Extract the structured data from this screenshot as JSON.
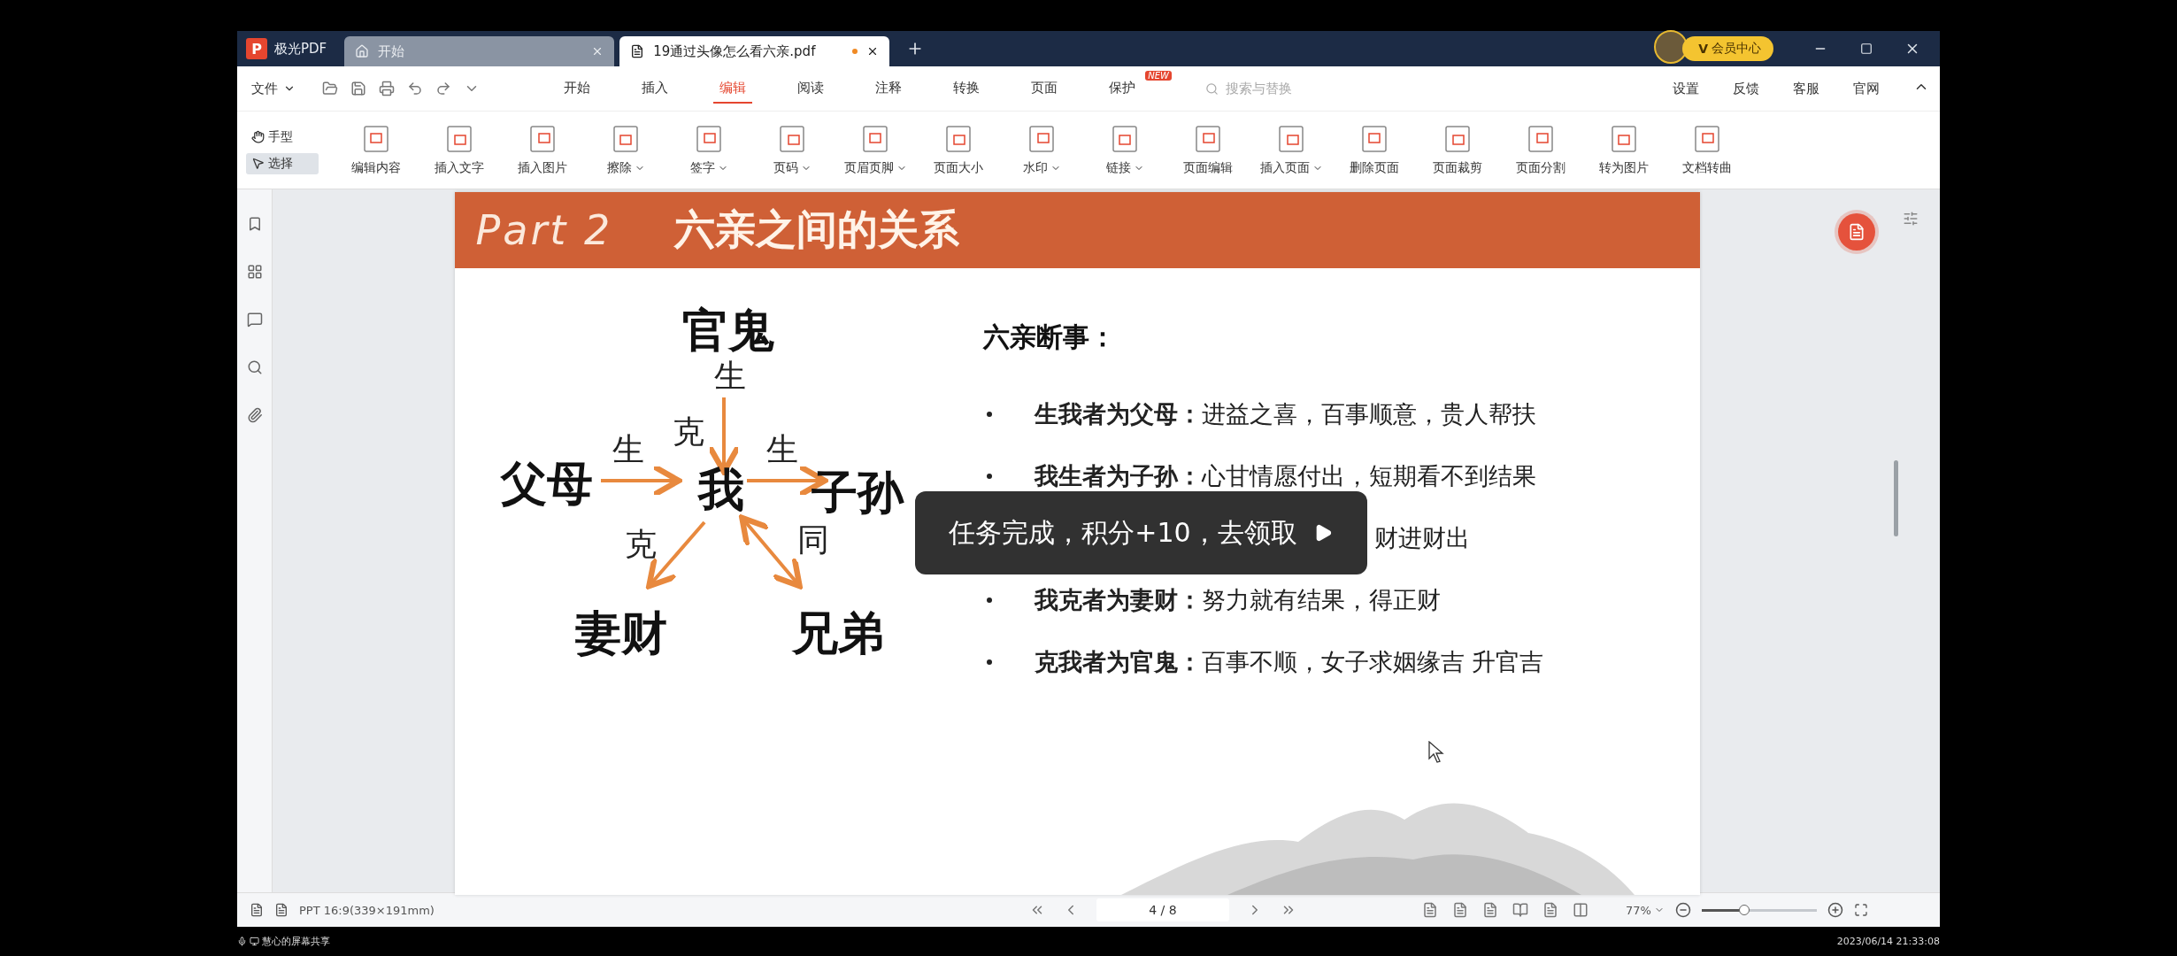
{
  "app": {
    "name": "极光PDF",
    "logo_letter": "P"
  },
  "tabs": [
    {
      "label": "开始",
      "selected": false,
      "unsaved": false
    },
    {
      "label": "19通过头像怎么看六亲.pdf",
      "selected": true,
      "unsaved": true
    }
  ],
  "member_button": {
    "mark": "V",
    "label": "会员中心"
  },
  "menu": {
    "file": "文件",
    "items": [
      {
        "label": "开始",
        "selected": false
      },
      {
        "label": "插入",
        "selected": false
      },
      {
        "label": "编辑",
        "selected": true
      },
      {
        "label": "阅读",
        "selected": false
      },
      {
        "label": "注释",
        "selected": false
      },
      {
        "label": "转换",
        "selected": false
      },
      {
        "label": "页面",
        "selected": false
      },
      {
        "label": "保护",
        "selected": false,
        "badge": "NEW"
      }
    ],
    "search": {
      "placeholder": "搜索与替换"
    },
    "links": [
      "设置",
      "反馈",
      "客服",
      "官网"
    ]
  },
  "tools": {
    "modes": [
      {
        "label": "手型",
        "selected": false
      },
      {
        "label": "选择",
        "selected": true
      }
    ],
    "items": [
      {
        "label": "编辑内容",
        "dropdown": false
      },
      {
        "label": "插入文字",
        "dropdown": false
      },
      {
        "label": "插入图片",
        "dropdown": false
      },
      {
        "label": "擦除",
        "dropdown": true
      },
      {
        "label": "签字",
        "dropdown": true
      },
      {
        "label": "页码",
        "dropdown": true
      },
      {
        "label": "页眉页脚",
        "dropdown": true
      },
      {
        "label": "页面大小",
        "dropdown": false
      },
      {
        "label": "水印",
        "dropdown": true
      },
      {
        "label": "链接",
        "dropdown": true
      },
      {
        "label": "页面编辑",
        "dropdown": false
      },
      {
        "label": "插入页面",
        "dropdown": true
      },
      {
        "label": "删除页面",
        "dropdown": false
      },
      {
        "label": "页面裁剪",
        "dropdown": false
      },
      {
        "label": "页面分割",
        "dropdown": false
      },
      {
        "label": "转为图片",
        "dropdown": false
      },
      {
        "label": "文档转曲",
        "dropdown": false
      }
    ]
  },
  "slide": {
    "part": "Part 2",
    "title": "六亲之间的关系",
    "diagram": {
      "nodes": [
        "官鬼",
        "父母",
        "我",
        "子孙",
        "妻财",
        "兄弟"
      ],
      "relation_labels": [
        "生",
        "克",
        "生",
        "生",
        "克",
        "同"
      ]
    },
    "list_title": "六亲断事：",
    "bullets": [
      {
        "kind": "full",
        "text": "**生我者为父母：**进益之喜，百事顺意，贵人帮扶"
      },
      {
        "kind": "full",
        "text": "**我生者为子孙：**心甘情愿付出，短期看不到结果"
      },
      {
        "kind": "partial",
        "text": "财进财出"
      },
      {
        "kind": "full",
        "text": "**我克者为妻财：**努力就有结果，得正财"
      },
      {
        "kind": "full",
        "text": "**克我者为官鬼：**百事不顺，女子求姻缘吉  升官吉"
      }
    ]
  },
  "toast": {
    "text": "任务完成，积分+10，去领取"
  },
  "status_bar": {
    "page_format": "PPT 16:9(339×191mm)",
    "page": "4 / 8",
    "zoom": "77%",
    "zoom_slider": {
      "level": 0.37
    }
  },
  "screen_share": {
    "label": "慧心的屏幕共享",
    "timestamp": "2023/06/14 21:33:08"
  }
}
